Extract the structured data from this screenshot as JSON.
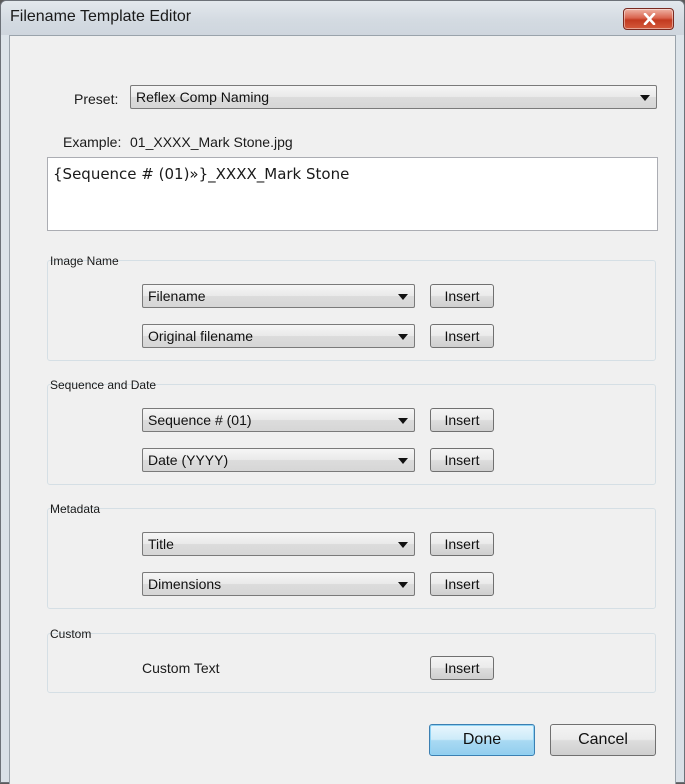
{
  "window": {
    "title": "Filename Template Editor"
  },
  "preset": {
    "label": "Preset:",
    "value": "Reflex Comp Naming"
  },
  "example": {
    "label": "Example:",
    "value": "01_XXXX_Mark Stone.jpg"
  },
  "template_text": "{Sequence # (01)»}_XXXX_Mark Stone",
  "groups": {
    "image_name": {
      "title": "Image Name",
      "rows": [
        {
          "select": "Filename",
          "button": "Insert"
        },
        {
          "select": "Original filename",
          "button": "Insert"
        }
      ]
    },
    "sequence_date": {
      "title": "Sequence and Date",
      "rows": [
        {
          "select": "Sequence # (01)",
          "button": "Insert"
        },
        {
          "select": "Date (YYYY)",
          "button": "Insert"
        }
      ]
    },
    "metadata": {
      "title": "Metadata",
      "rows": [
        {
          "select": "Title",
          "button": "Insert"
        },
        {
          "select": "Dimensions",
          "button": "Insert"
        }
      ]
    },
    "custom": {
      "title": "Custom",
      "label": "Custom Text",
      "button": "Insert"
    }
  },
  "footer": {
    "done": "Done",
    "cancel": "Cancel"
  },
  "icons": {
    "close": "close-icon",
    "dropdown": "chevron-down-icon"
  },
  "colors": {
    "default_button_border": "#3c7fb1",
    "close_button": "#c23a20"
  }
}
